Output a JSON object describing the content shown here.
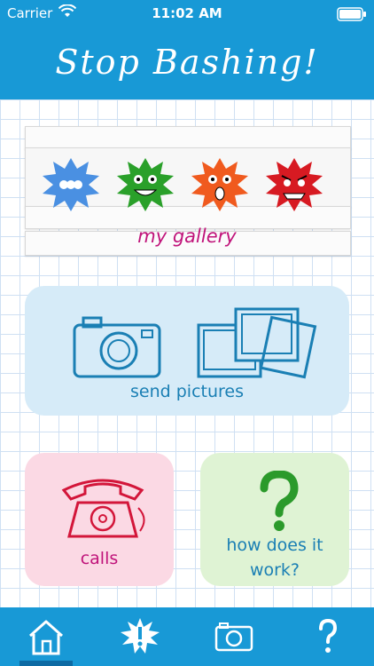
{
  "status": {
    "carrier": "Carrier",
    "time": "11:02 AM"
  },
  "header": {
    "title": "Stop Bashing!"
  },
  "gallery": {
    "label": "my gallery",
    "characters": [
      {
        "name": "blue-bug-icon",
        "color": "#4a90e2"
      },
      {
        "name": "green-bug-icon",
        "color": "#2aa02a"
      },
      {
        "name": "orange-bug-icon",
        "color": "#f05a1e"
      },
      {
        "name": "red-bug-icon",
        "color": "#d71a22"
      }
    ]
  },
  "tiles": {
    "send_pictures": "send pictures",
    "calls": "calls",
    "how": "how does it\nwork?"
  },
  "tabbar": {
    "items": [
      {
        "name": "home-tab",
        "icon": "home-icon"
      },
      {
        "name": "alert-tab",
        "icon": "alert-splat-icon"
      },
      {
        "name": "camera-tab",
        "icon": "camera-icon"
      },
      {
        "name": "help-tab",
        "icon": "question-mark-icon"
      }
    ],
    "selected": "home-tab"
  },
  "colors": {
    "header": "#1899d6",
    "accent_magenta": "#c0137a",
    "accent_blue": "#1a7fb4",
    "accent_red": "#d3163a",
    "accent_green": "#2b9a2b"
  }
}
